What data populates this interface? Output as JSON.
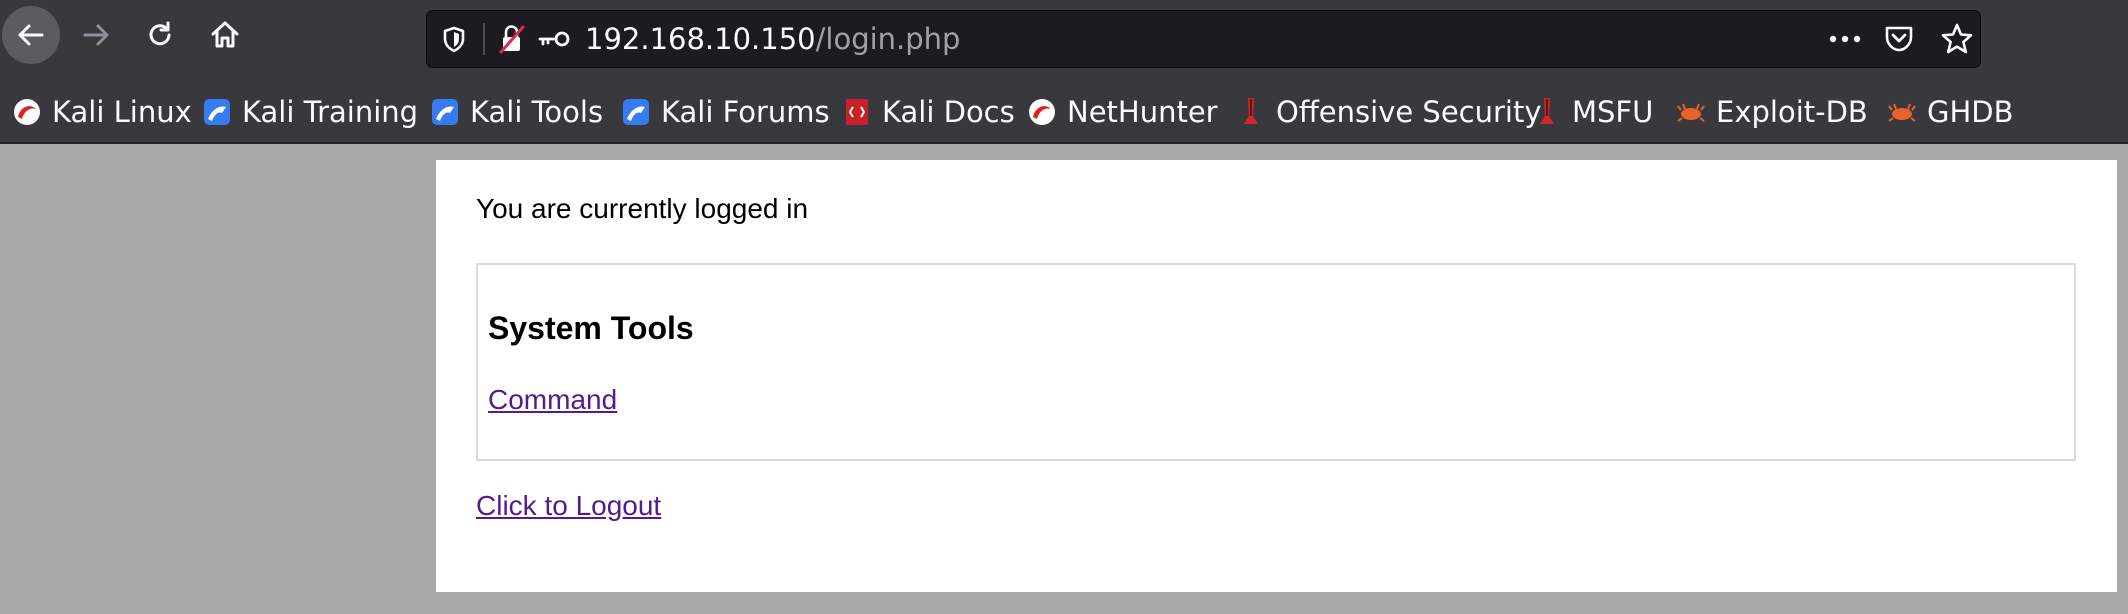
{
  "urlbar": {
    "host": "192.168.10.150",
    "path": "/login.php"
  },
  "icons": {
    "back": "arrow-left-icon",
    "forward": "arrow-right-icon",
    "reload": "reload-icon",
    "home": "home-icon",
    "shield": "shield-icon",
    "insecure_lock": "insecure-lock-icon",
    "key": "key-icon",
    "more": "more-dots-icon",
    "pocket": "pocket-icon",
    "star": "star-icon"
  },
  "bookmarks": [
    {
      "label": "Kali Linux",
      "icon": "kali-dragon-icon"
    },
    {
      "label": "Kali Training",
      "icon": "kali-training-icon"
    },
    {
      "label": "Kali Tools",
      "icon": "kali-tools-icon"
    },
    {
      "label": "Kali Forums",
      "icon": "kali-forums-icon"
    },
    {
      "label": "Kali Docs",
      "icon": "kali-docs-icon"
    },
    {
      "label": "NetHunter",
      "icon": "nethunter-icon"
    },
    {
      "label": "Offensive Security",
      "icon": "offsec-icon"
    },
    {
      "label": "MSFU",
      "icon": "msfu-icon"
    },
    {
      "label": "Exploit-DB",
      "icon": "exploit-db-icon"
    },
    {
      "label": "GHDB",
      "icon": "ghdb-icon"
    }
  ],
  "page": {
    "status": "You are currently logged in",
    "tools_title": "System Tools",
    "command_link": "Command",
    "logout_link": "Click to Logout"
  },
  "colors": {
    "toolbar_bg": "#38383d",
    "urlbar_bg": "#1c1b22",
    "page_bg": "#a8a8a8",
    "visited_link": "#551a8b"
  }
}
